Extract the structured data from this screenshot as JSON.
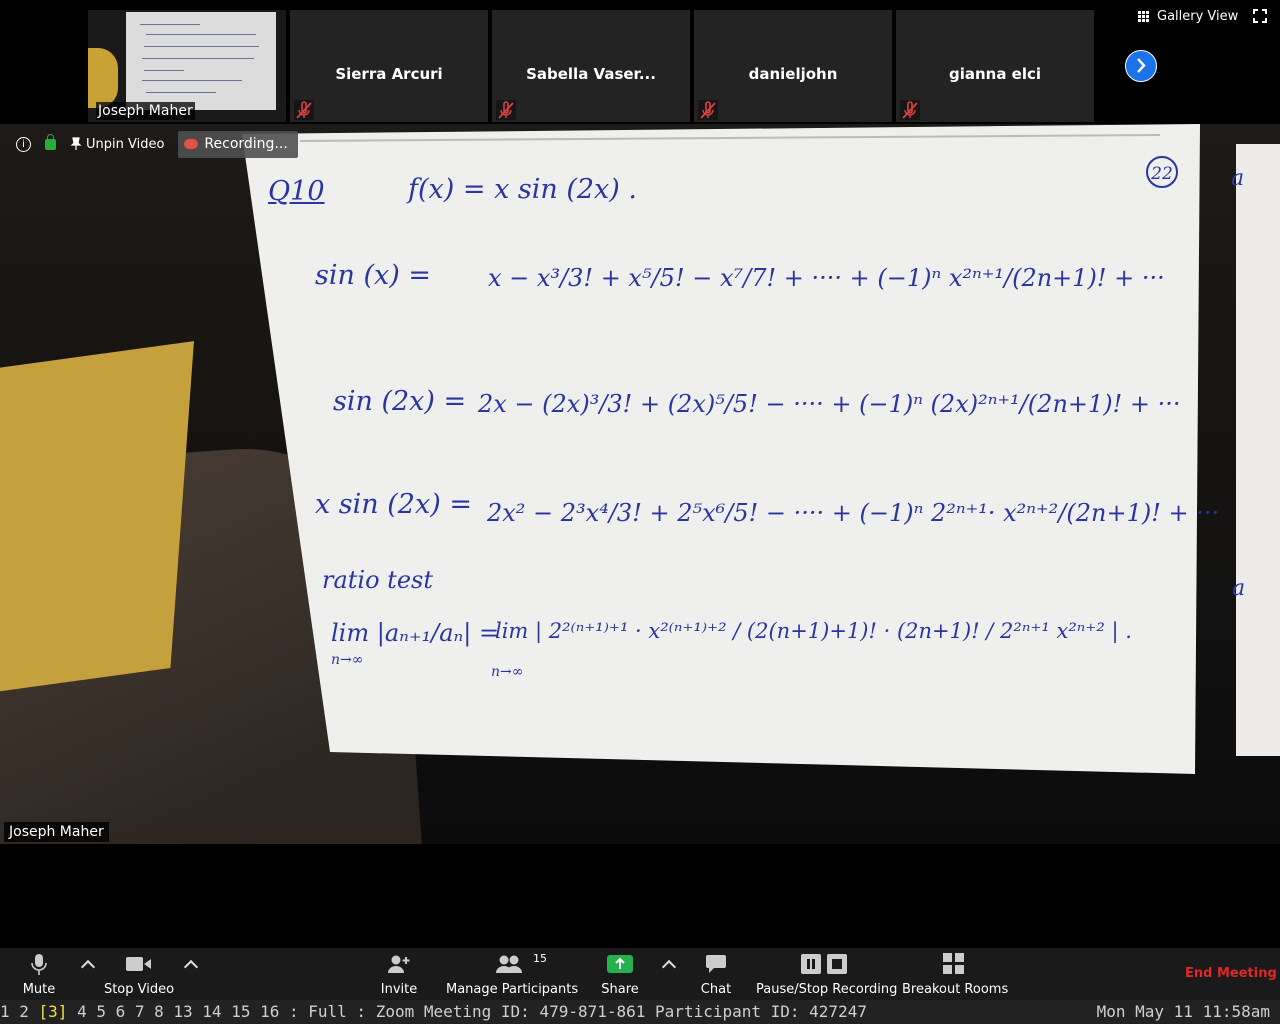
{
  "participants": {
    "self_name": "Joseph Maher",
    "others": [
      "Sierra Arcuri",
      "Sabella Vaser...",
      "danieljohn",
      "gianna elci"
    ]
  },
  "view": {
    "gallery_label": "Gallery View",
    "unpin_label": "Unpin Video",
    "recording_label": "Recording..."
  },
  "main_video": {
    "speaker_name": "Joseph Maher",
    "page_number": "22",
    "paper2_text": [
      "a",
      "a"
    ],
    "whiteboard_lines": {
      "q_label": "Q10",
      "func": "f(x)  =  x sin (2x) .",
      "sin_lhs": "sin (x)  =",
      "sin_rhs": "x −  x³/3!  +  x⁵/5!  −  x⁷/7!  + ···· + (−1)ⁿ x²ⁿ⁺¹/(2n+1)!  + ···",
      "sin2_lhs": "sin (2x)  =",
      "sin2_rhs": "2x  −  (2x)³/3!  +  (2x)⁵/5!  − ····  +  (−1)ⁿ (2x)²ⁿ⁺¹/(2n+1)!  + ···",
      "xsin_lhs": "x sin (2x)  =",
      "xsin_rhs": "2x²  −  2³x⁴/3!  +  2⁵x⁶/5!  − ····  +  (−1)ⁿ 2²ⁿ⁺¹· x²ⁿ⁺²/(2n+1)!  + ···",
      "ratio": "ratio test",
      "lim_lhs": "lim |aₙ₊₁/aₙ|  =",
      "lim_rhs": "lim  | 2²⁽ⁿ⁺¹⁾⁺¹ · x²⁽ⁿ⁺¹⁾⁺² / (2(n+1)+1)!   ·  (2n+1)! / 2²ⁿ⁺¹ x²ⁿ⁺² | .",
      "lim_sub": "n→∞"
    }
  },
  "toolbar": {
    "mute": "Mute",
    "stop_video": "Stop Video",
    "invite": "Invite",
    "manage_participants": "Manage Participants",
    "participant_count": "15",
    "share": "Share",
    "chat": "Chat",
    "recording": "Pause/Stop Recording",
    "breakout": "Breakout Rooms",
    "end_meeting": "End Meeting"
  },
  "status_bar": {
    "workspaces_pre": "1 2 ",
    "current_workspace": "[3]",
    "workspaces_post": " 4 5 6 7 8 13 14 15 16 : Full : Zoom Meeting ID: 479-871-861 Participant ID: 427247",
    "clock": "Mon May 11 11:58am"
  },
  "colors": {
    "end_meeting": "#e02828",
    "share_green": "#22b14c",
    "ink": "#2a35a0",
    "next_button": "#1a73e8"
  }
}
